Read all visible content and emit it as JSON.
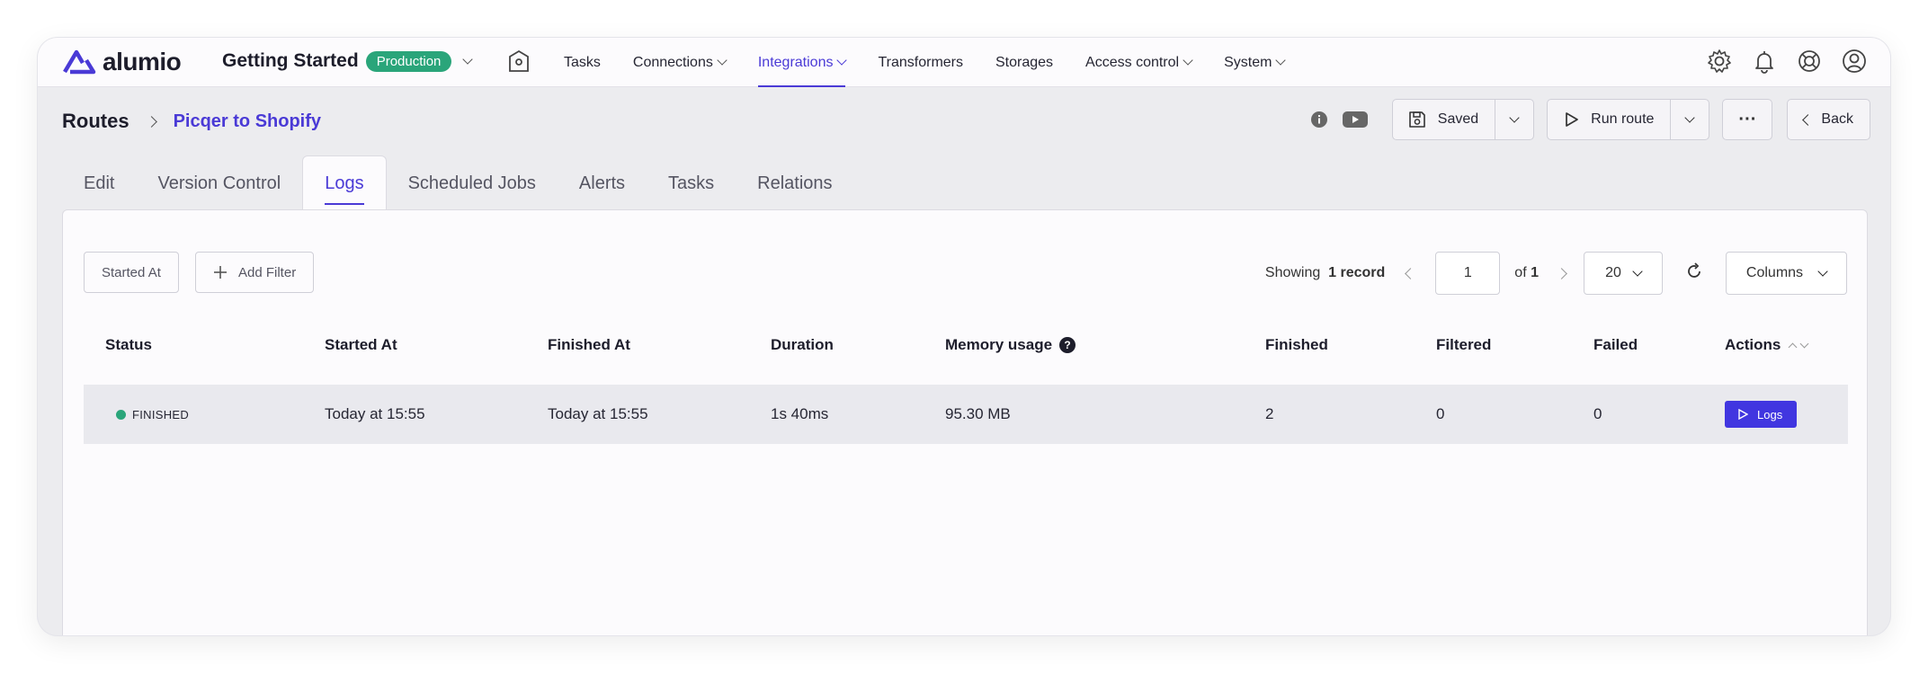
{
  "brand": {
    "logo_text": "alumio",
    "logo_icon": "alumio-logo-icon"
  },
  "workspace": {
    "title": "Getting Started",
    "environment": "Production"
  },
  "nav": {
    "items": [
      {
        "label": "Tasks",
        "dropdown": false,
        "active": false
      },
      {
        "label": "Connections",
        "dropdown": true,
        "active": false
      },
      {
        "label": "Integrations",
        "dropdown": true,
        "active": true
      },
      {
        "label": "Transformers",
        "dropdown": false,
        "active": false
      },
      {
        "label": "Storages",
        "dropdown": false,
        "active": false
      },
      {
        "label": "Access control",
        "dropdown": true,
        "active": false
      },
      {
        "label": "System",
        "dropdown": true,
        "active": false
      }
    ],
    "right_icons": [
      "gear-icon",
      "bell-icon",
      "lifebuoy-icon",
      "user-icon"
    ]
  },
  "breadcrumb": {
    "root": "Routes",
    "current": "Picqer to Shopify"
  },
  "header_actions": {
    "saved_label": "Saved",
    "run_label": "Run route",
    "more_label": "···",
    "back_label": "Back"
  },
  "tabs": [
    "Edit",
    "Version Control",
    "Logs",
    "Scheduled Jobs",
    "Alerts",
    "Tasks",
    "Relations"
  ],
  "active_tab": "Logs",
  "filters": {
    "started_at": "Started At",
    "add_filter": "Add Filter"
  },
  "pagination": {
    "showing_label": "Showing",
    "record_count": "1 record",
    "page": "1",
    "of_label": "of",
    "total_pages": "1",
    "page_size": "20",
    "columns_label": "Columns"
  },
  "table": {
    "headers": [
      "Status",
      "Started At",
      "Finished At",
      "Duration",
      "Memory usage",
      "Finished",
      "Filtered",
      "Failed",
      "Actions"
    ],
    "help_glyph": "?",
    "rows": [
      {
        "status": "FINISHED",
        "started_at": "Today at 15:55",
        "finished_at": "Today at 15:55",
        "duration": "1s 40ms",
        "memory": "95.30 MB",
        "finished": "2",
        "filtered": "0",
        "failed": "0",
        "action_label": "Logs"
      }
    ]
  },
  "colors": {
    "accent": "#4a3ad6",
    "success": "#2aa57a",
    "action": "#4136e0"
  }
}
